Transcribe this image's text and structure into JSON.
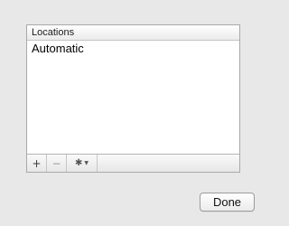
{
  "locations_list": {
    "header": "Locations",
    "items": [
      {
        "label": "Automatic"
      }
    ]
  },
  "toolbar": {
    "add_label": "+",
    "remove_label": "−",
    "action_icon": "gear-icon",
    "action_menu_icon": "chevron-down-icon"
  },
  "footer": {
    "done_label": "Done"
  }
}
